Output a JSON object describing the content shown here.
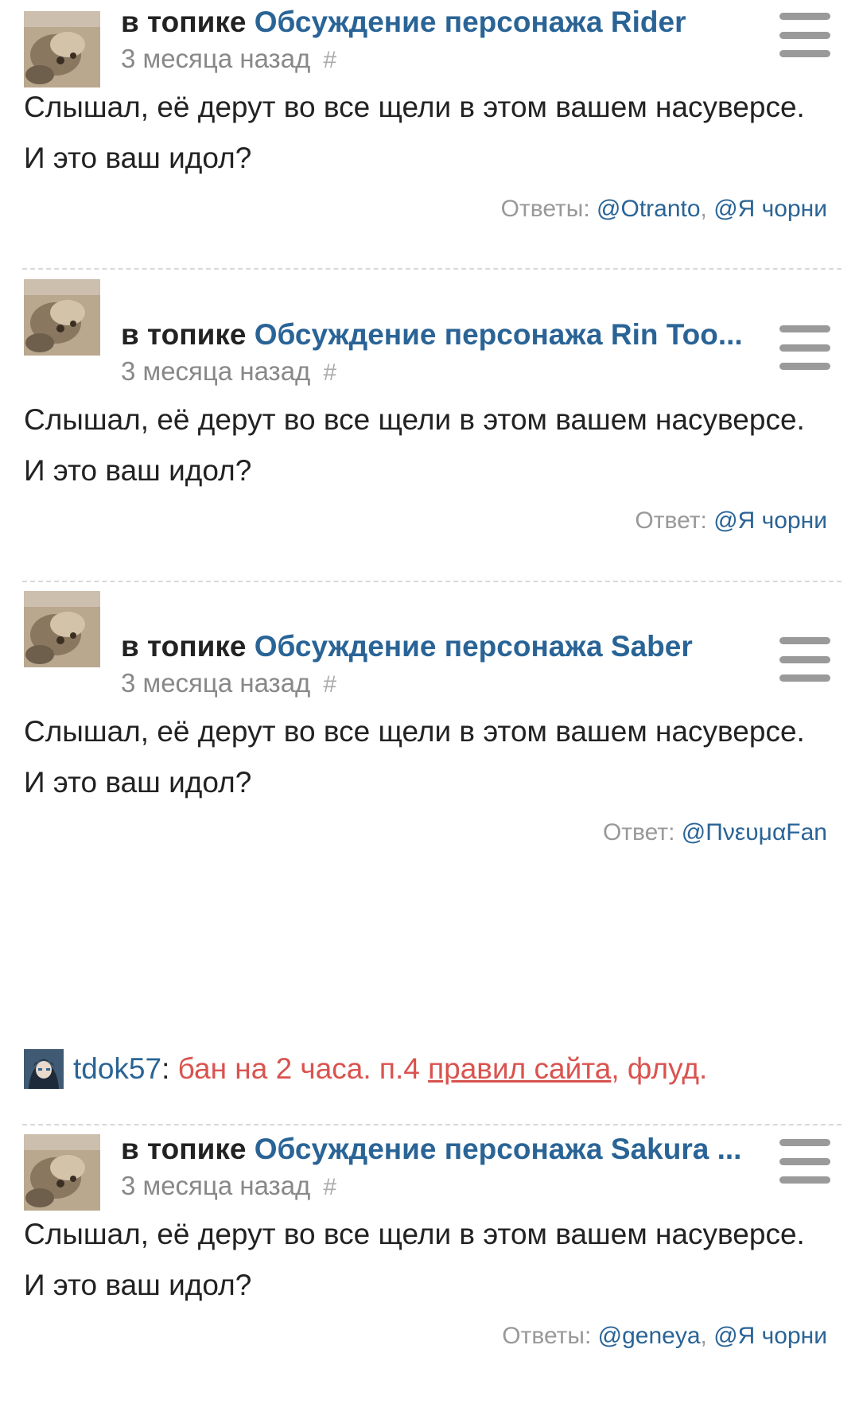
{
  "comments": [
    {
      "topic_prefix": "в топике",
      "topic_title": "Обсуждение персонажа Rider",
      "time": "3 месяца назад",
      "hash": "#",
      "text": "Слышал, её дерут во все щели в этом вашем насуверсе. И это ваш идол?",
      "replies_label": "Ответы:",
      "replies": [
        "@Otranto",
        "@Я чорни"
      ]
    },
    {
      "topic_prefix": "в топике",
      "topic_title": "Обсуждение персонажа Rin Too...",
      "time": "3 месяца назад",
      "hash": "#",
      "text": "Слышал, её дерут во все щели в этом вашем насуверсе. И это ваш идол?",
      "replies_label": "Ответ:",
      "replies": [
        "@Я чорни"
      ]
    },
    {
      "topic_prefix": "в топике",
      "topic_title": "Обсуждение персонажа Saber",
      "time": "3 месяца назад",
      "hash": "#",
      "text": "Слышал, её дерут во все щели в этом вашем насуверсе. И это ваш идол?",
      "replies_label": "Ответ:",
      "replies": [
        "@ΠνευμαFan"
      ]
    },
    {
      "topic_prefix": "в топике",
      "topic_title": "Обсуждение персонажа Sakura ...",
      "time": "3 месяца назад",
      "hash": "#",
      "text": "Слышал, её дерут во все щели в этом вашем насуверсе. И это ваш идол?",
      "replies_label": "Ответы:",
      "replies": [
        "@geneya",
        "@Я чорни"
      ]
    }
  ],
  "ban": {
    "user": "tdok57",
    "colon": ":",
    "text_before": " бан на 2 часа. п.4 ",
    "link": "правил сайта",
    "text_after": ", флуд."
  },
  "icons": {
    "menu": "hamburger-menu-icon",
    "avatar": "cat-avatar-image",
    "ban_avatar": "user-avatar-image"
  },
  "colors": {
    "link": "#2a6496",
    "ban_text": "#d9534f",
    "muted": "#888888",
    "body_text": "#222222"
  }
}
